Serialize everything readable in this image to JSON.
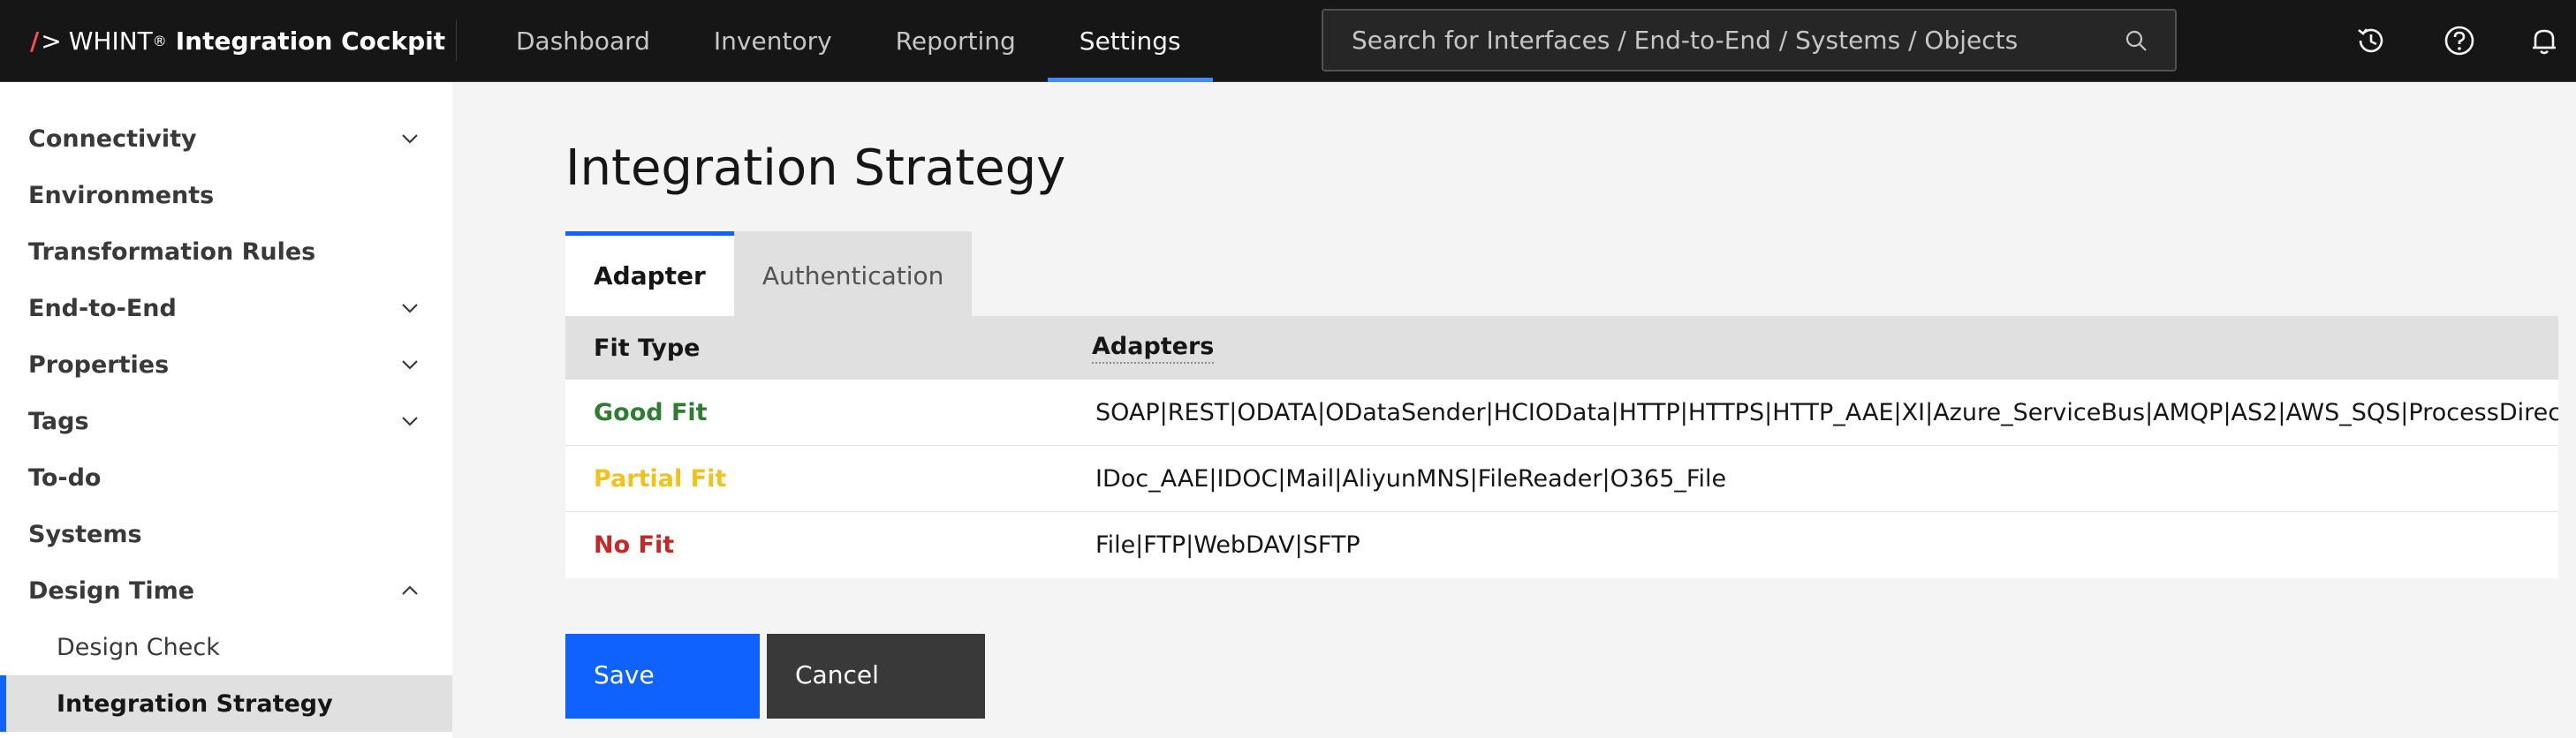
{
  "header": {
    "brand_prefix": "WHINT",
    "brand_reg": "®",
    "brand_name": "Integration Cockpit",
    "nav": [
      {
        "label": "Dashboard"
      },
      {
        "label": "Inventory"
      },
      {
        "label": "Reporting"
      },
      {
        "label": "Settings",
        "active": true
      }
    ],
    "search_placeholder": "Search for Interfaces / End-to-End / Systems / Objects",
    "icons": [
      "history-icon",
      "help-icon",
      "notification-icon"
    ]
  },
  "sidebar": {
    "items": [
      {
        "label": "Connectivity",
        "expandable": true,
        "expanded": false
      },
      {
        "label": "Environments",
        "expandable": false
      },
      {
        "label": "Transformation Rules",
        "expandable": false
      },
      {
        "label": "End-to-End",
        "expandable": true,
        "expanded": false
      },
      {
        "label": "Properties",
        "expandable": true,
        "expanded": false
      },
      {
        "label": "Tags",
        "expandable": true,
        "expanded": false
      },
      {
        "label": "To-do",
        "expandable": false
      },
      {
        "label": "Systems",
        "expandable": false
      },
      {
        "label": "Design Time",
        "expandable": true,
        "expanded": true
      }
    ],
    "subitems": [
      {
        "label": "Design Check"
      },
      {
        "label": "Integration Strategy",
        "active": true
      }
    ]
  },
  "main": {
    "title": "Integration Strategy",
    "tabs": [
      {
        "label": "Adapter",
        "active": true
      },
      {
        "label": "Authentication",
        "active": false
      }
    ],
    "table": {
      "headers": [
        "Fit Type",
        "Adapters"
      ],
      "rows": [
        {
          "fit": "Good Fit",
          "adapters": "SOAP|REST|ODATA|ODataSender|HCIOData|HTTP|HTTPS|HTTP_AAE|XI|Azure_ServiceBus|AMQP|AS2|AWS_SQS|ProcessDirec"
        },
        {
          "fit": "Partial Fit",
          "adapters": "IDoc_AAE|IDOC|Mail|AliyunMNS|FileReader|O365_File"
        },
        {
          "fit": "No Fit",
          "adapters": "File|FTP|WebDAV|SFTP"
        }
      ]
    },
    "buttons": {
      "save": "Save",
      "cancel": "Cancel"
    }
  },
  "colors": {
    "good_fit": "#2e7d32",
    "partial_fit": "#f1c21b",
    "no_fit": "#c62828",
    "accent": "#0f62fe"
  }
}
